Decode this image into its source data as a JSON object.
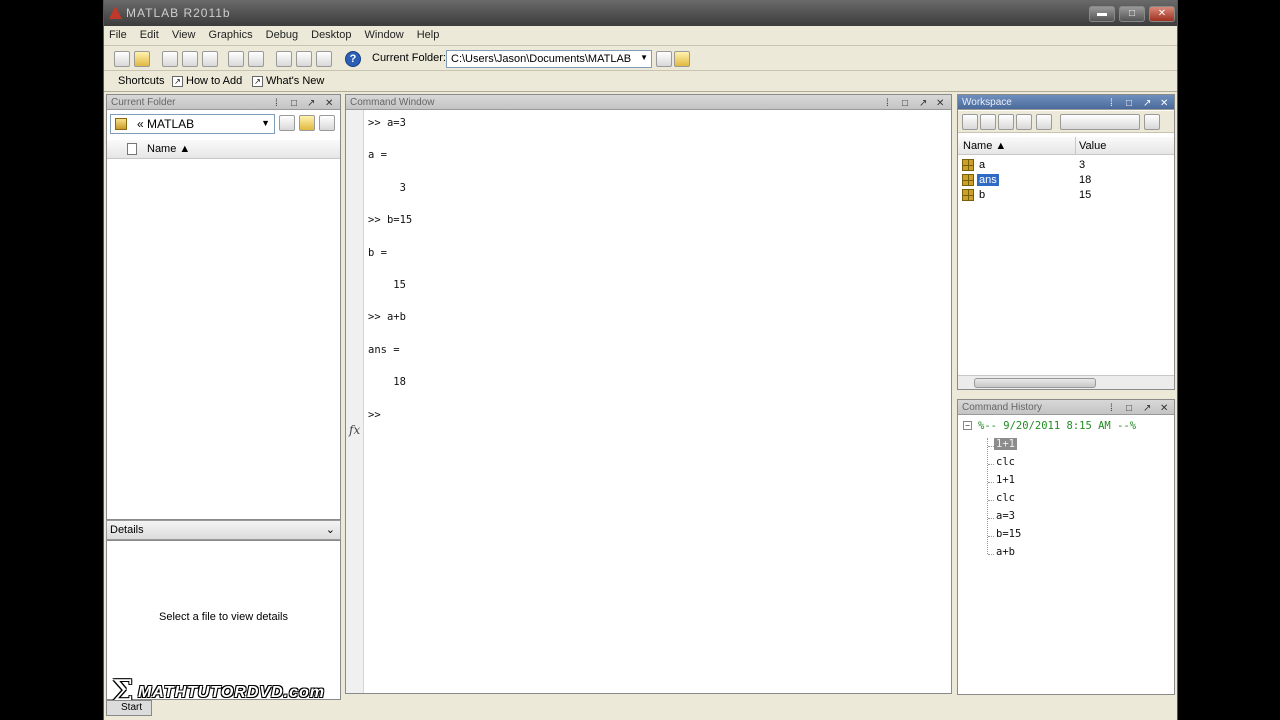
{
  "window": {
    "title": "MATLAB R2011b",
    "min": "▬",
    "max": "□",
    "close": "✕"
  },
  "menu": [
    "File",
    "Edit",
    "View",
    "Graphics",
    "Debug",
    "Desktop",
    "Window",
    "Help"
  ],
  "toolbar": {
    "current_folder_label": "Current Folder:",
    "current_folder_path": "C:\\Users\\Jason\\Documents\\MATLAB",
    "help_glyph": "?"
  },
  "shortcuts": [
    {
      "label": "Shortcuts"
    },
    {
      "label": "How to Add"
    },
    {
      "label": "What's New"
    }
  ],
  "current_folder": {
    "title": "Current Folder",
    "path": "MATLAB",
    "path_prefix": "«",
    "column_name": "Name ▲",
    "details_label": "Details",
    "details_message": "Select a file to view details"
  },
  "command_window": {
    "title": "Command Window",
    "lines": [
      ">> a=3",
      "",
      "a =",
      "",
      "     3",
      "",
      ">> b=15",
      "",
      "b =",
      "",
      "    15",
      "",
      ">> a+b",
      "",
      "ans =",
      "",
      "    18",
      "",
      ">>"
    ],
    "fx": "fx"
  },
  "workspace": {
    "title": "Workspace",
    "col_name": "Name ▲",
    "col_value": "Value",
    "rows": [
      {
        "name": "a",
        "value": "3",
        "selected": false
      },
      {
        "name": "ans",
        "value": "18",
        "selected": true
      },
      {
        "name": "b",
        "value": "15",
        "selected": false
      }
    ]
  },
  "history": {
    "title": "Command History",
    "session": "%-- 9/20/2011 8:15 AM --%",
    "items": [
      "1+1",
      "clc",
      "1+1",
      "clc",
      "a=3",
      "b=15",
      "a+b"
    ],
    "selected_index": 0
  },
  "watermark": {
    "brand": "MATHTUTORDVD.com",
    "start": "Start"
  },
  "colors": {
    "selection": "#316ac5",
    "panel_title_active": "#4a6a9a"
  }
}
